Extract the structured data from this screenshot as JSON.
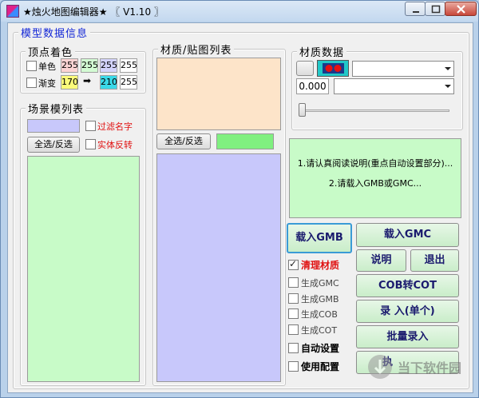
{
  "window": {
    "title": "★烛火地图编辑器★ 〖 V1.10 〗"
  },
  "model_group": {
    "title": "模型数据信息"
  },
  "vertex_color": {
    "title": "顶点着色",
    "mono": {
      "label": "单色",
      "checked": false,
      "r": "255",
      "g": "255",
      "b": "255",
      "a": "255"
    },
    "gradient": {
      "label": "渐变",
      "checked": false,
      "from": "170",
      "arrow": "➡",
      "to": "210",
      "a": "255"
    }
  },
  "scene_list": {
    "title": "场景模列表",
    "filter_label": "过滤名字",
    "select_all": "全选/反选",
    "invert_label": "实体反转"
  },
  "material_list": {
    "title": "材质/贴图列表",
    "select_all": "全选/反选"
  },
  "material_data": {
    "title": "材质数据",
    "value": "0.000"
  },
  "info": {
    "line1": "1.请认真阅读说明(重点自动设置部分)...",
    "line2": "2.请载入GMB或GMC..."
  },
  "buttons": {
    "load_gmb": "载入GMB",
    "load_gmc": "载入GMC",
    "readme": "说明",
    "exit": "退出",
    "cob_to_cot": "COB转COT",
    "record_single": "录 入(单个)",
    "batch_record": "批量录入",
    "last": "执"
  },
  "options": [
    {
      "label": "清理材质",
      "checked": true
    },
    {
      "label": "生成GMC",
      "checked": false
    },
    {
      "label": "生成GMB",
      "checked": false
    },
    {
      "label": "生成COB",
      "checked": false
    },
    {
      "label": "生成COT",
      "checked": false
    },
    {
      "label": "自动设置",
      "checked": false
    },
    {
      "label": "使用配置",
      "checked": false
    }
  ],
  "watermark": "当下软件园",
  "colors": {
    "window_bg": "#b9d1ea",
    "client_bg": "#f0f0f0",
    "peach_panel": "#fde4c9",
    "lavender_panel": "#c8c8fb",
    "green_panel": "#c8fbc8",
    "accent_red": "#e01010"
  }
}
